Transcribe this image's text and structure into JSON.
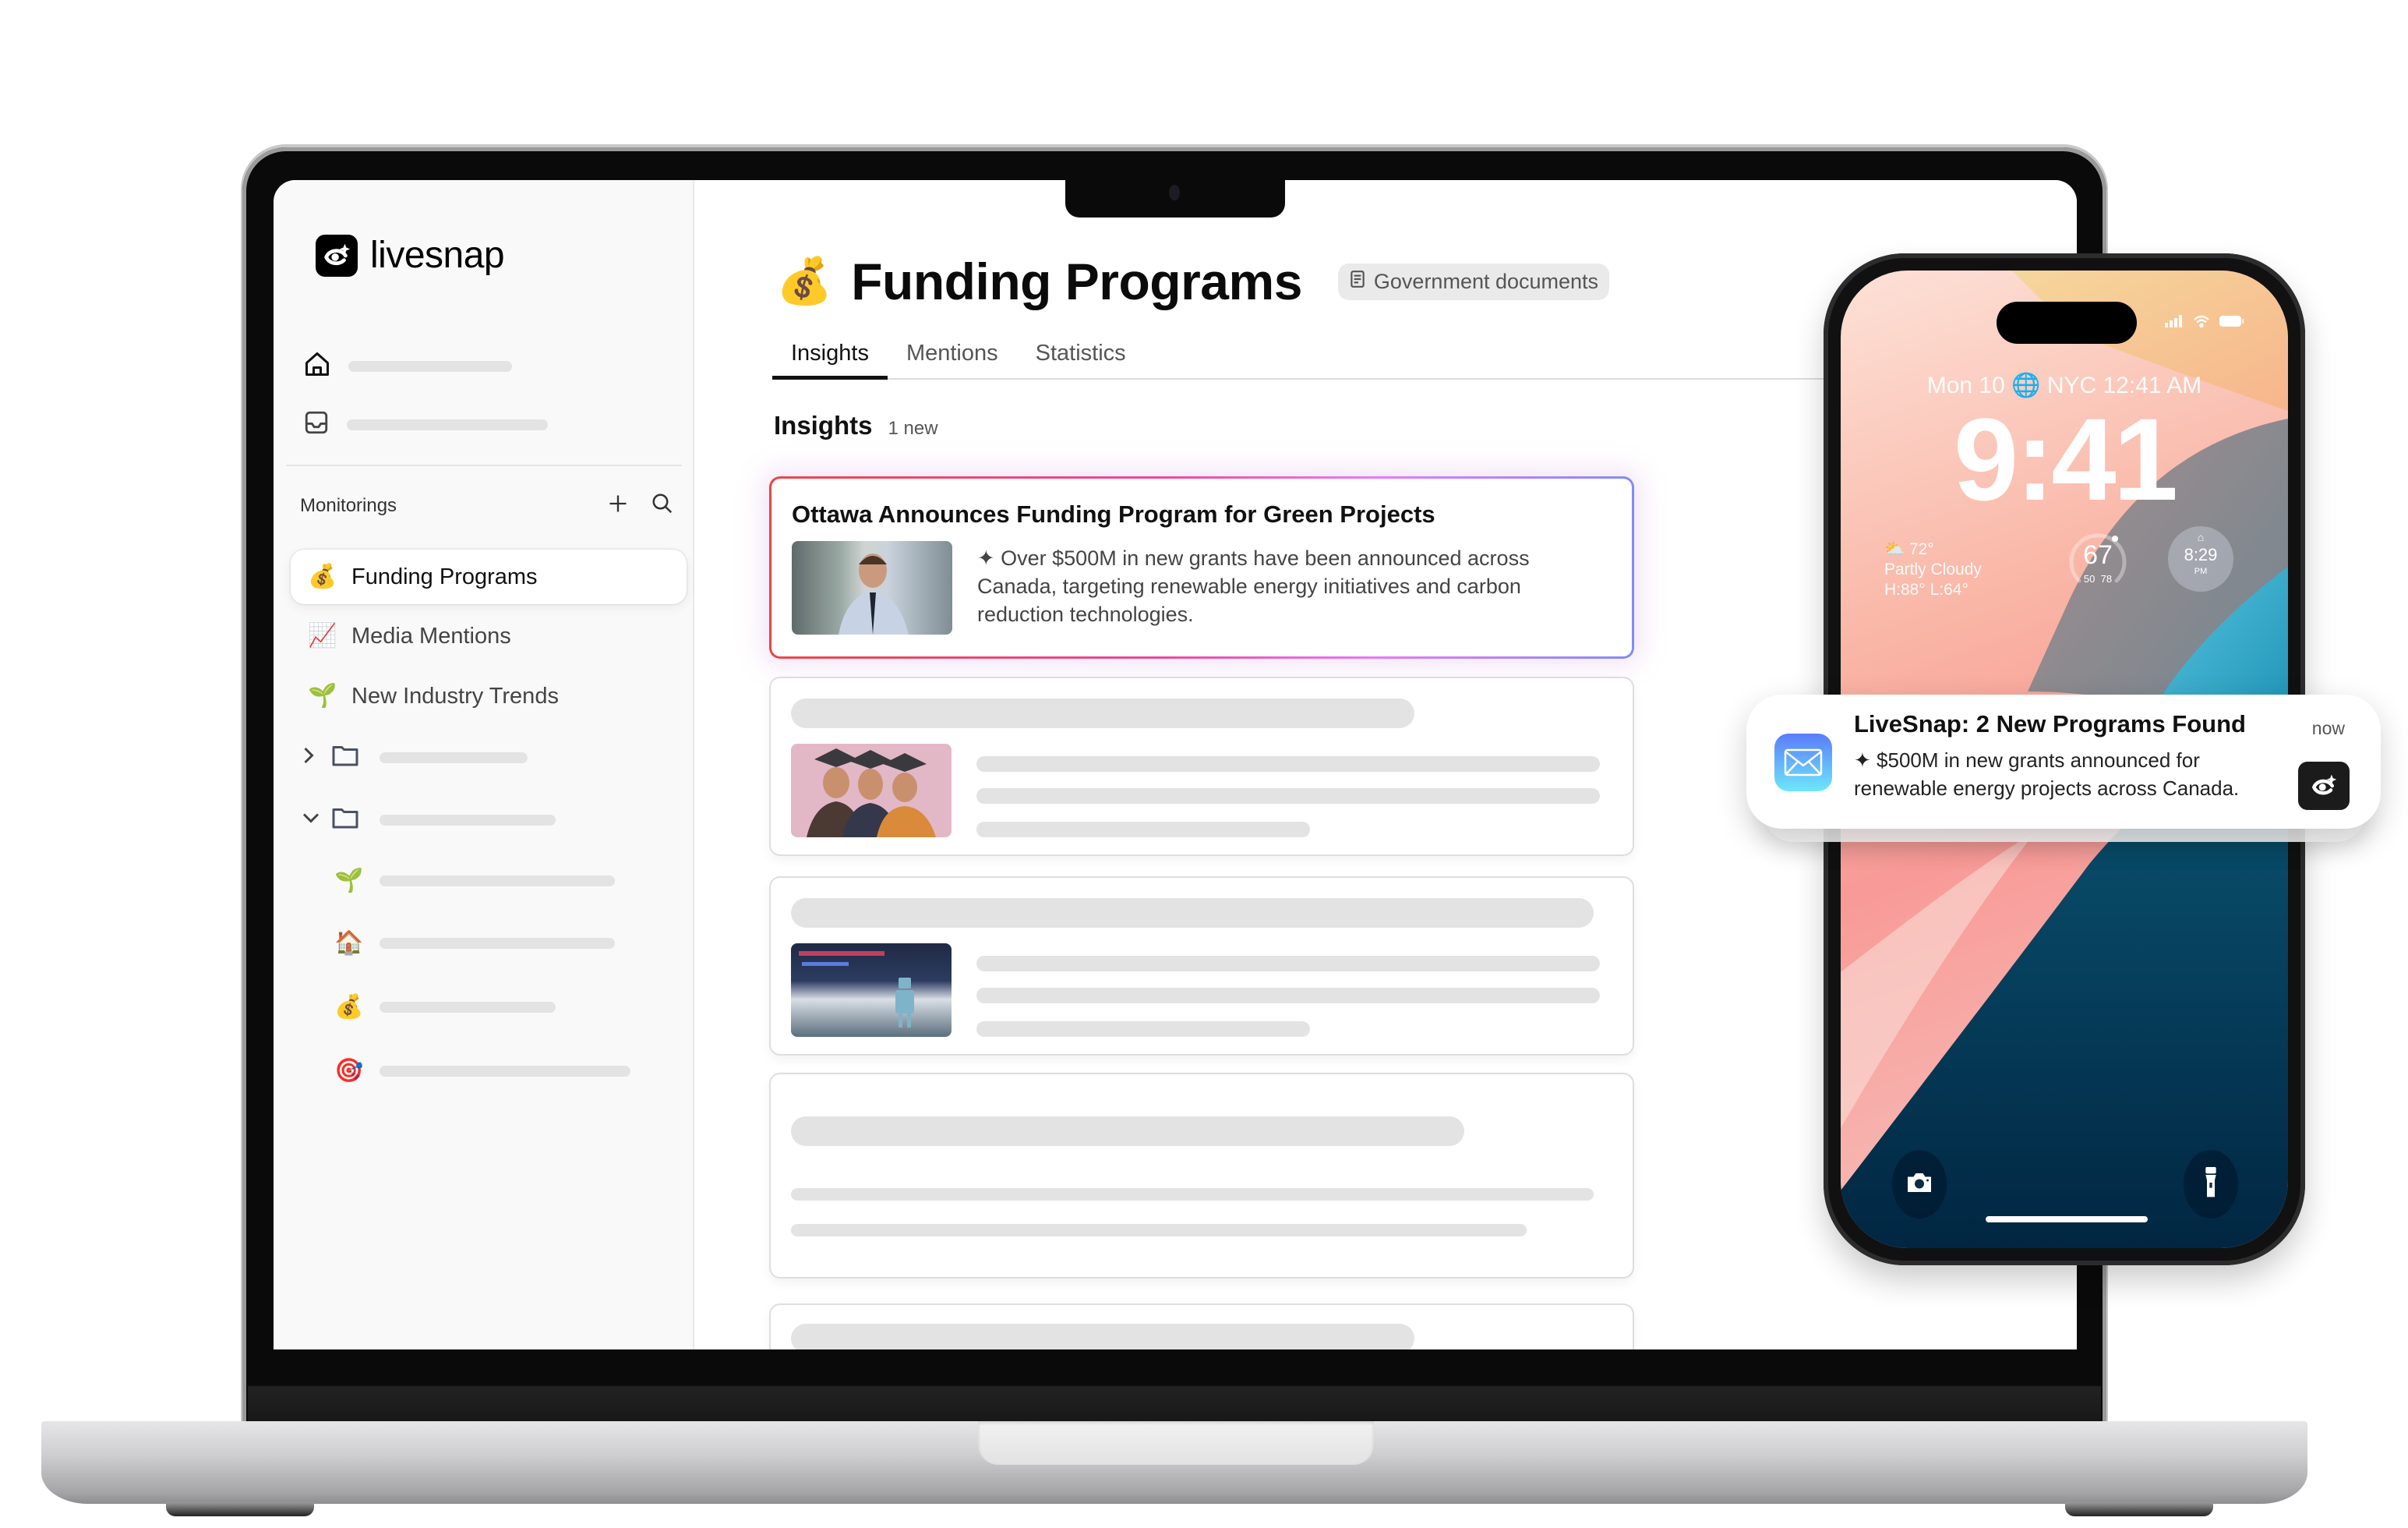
{
  "app": {
    "name": "livesnap",
    "nav": [
      {
        "icon": "home-icon"
      },
      {
        "icon": "inbox-icon"
      }
    ],
    "monitorings": {
      "title": "Monitorings",
      "add_icon": "plus-icon",
      "search_icon": "search-icon",
      "items": [
        {
          "emoji": "💰",
          "label": "Funding Programs",
          "active": true
        },
        {
          "emoji": "📈",
          "label": "Media Mentions",
          "active": false
        },
        {
          "emoji": "🌱",
          "label": "New Industry Trends",
          "active": false
        }
      ],
      "folders": [
        {
          "state": "collapsed",
          "chevron": "›"
        },
        {
          "state": "expanded",
          "chevron": "⌄",
          "children": [
            "🌱",
            "🏠",
            "💰",
            "🎯"
          ]
        }
      ]
    }
  },
  "page": {
    "emoji": "💰",
    "title": "Funding Programs",
    "tag": "Government documents",
    "tabs": [
      {
        "label": "Insights",
        "active": true
      },
      {
        "label": "Mentions",
        "active": false
      },
      {
        "label": "Statistics",
        "active": false
      }
    ],
    "section_title": "Insights",
    "section_count": "1 new"
  },
  "insights": [
    {
      "title": "Ottawa Announces Funding Program for Green Projects",
      "summary_icon": "✦",
      "summary": "Over $500M in new grants have been announced across Canada, targeting renewable energy initiatives and carbon reduction technologies.",
      "image": "businessman-office-photo",
      "highlighted": true
    },
    {
      "loading": true,
      "image": "graduates-photo"
    },
    {
      "loading": true,
      "image": "robot-toy-photo"
    },
    {
      "loading": true
    },
    {
      "loading": true
    }
  ],
  "phone": {
    "date_line": "Mon 10 🌐 NYC 12:41 AM",
    "time": "9:41",
    "weather": {
      "temp": "72°",
      "condition": "Partly Cloudy",
      "range": "H:88° L:64°"
    },
    "gauge": {
      "value": "67",
      "low": "50",
      "high": "78"
    },
    "sunset": {
      "time": "8:29",
      "period": "PM"
    },
    "notification": {
      "app_icon": "mail-icon",
      "title": "LiveSnap: 2 New Programs Found",
      "time": "now",
      "icon": "✦",
      "body": "$500M in new grants announced for renewable energy projects across Canada."
    }
  },
  "colors": {
    "highlight_gradient": [
      "#ef4444",
      "#ec4899",
      "#e879f9",
      "#818cf8"
    ],
    "skeleton": "#e3e3e3"
  }
}
